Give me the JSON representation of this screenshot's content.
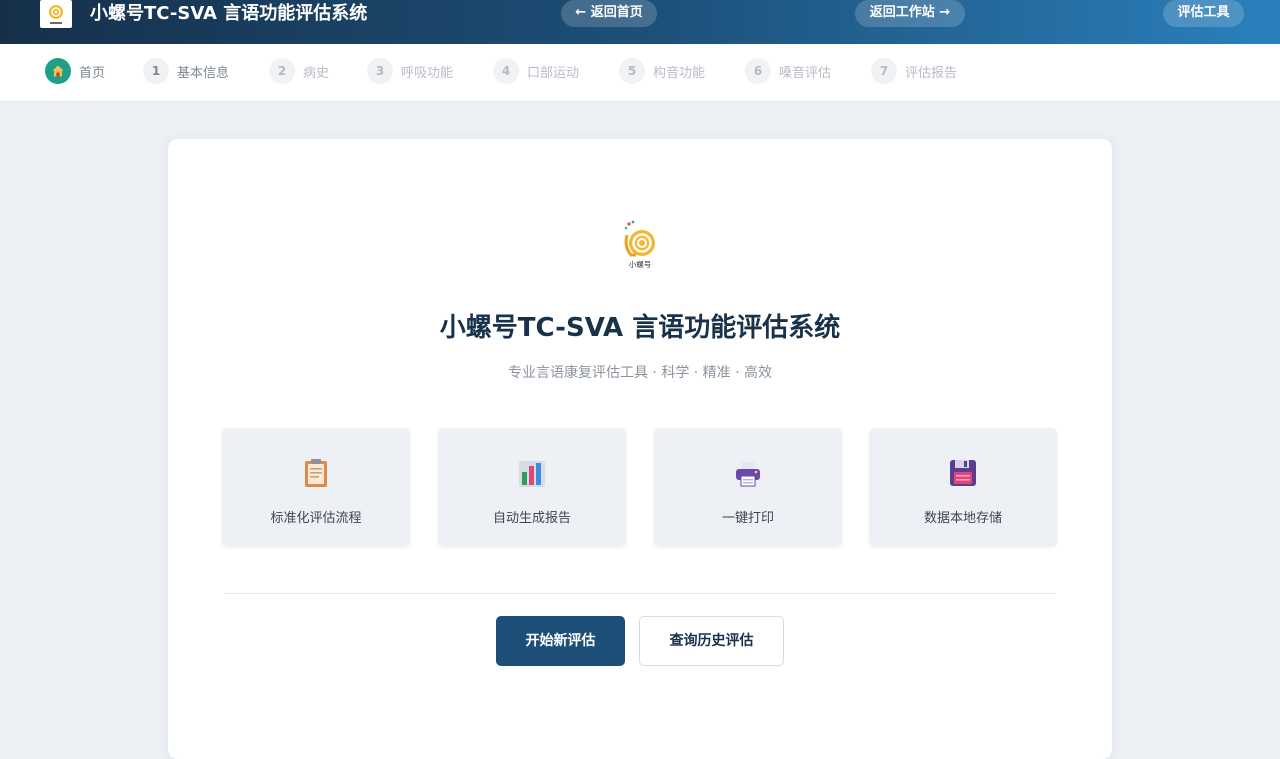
{
  "header": {
    "logo_icon": "snail-logo-icon",
    "title": "小螺号TC-SVA 言语功能评估系统",
    "back_home_label": "← 返回首页",
    "back_workstation_label": "返回工作站 →",
    "tools_label": "评估工具"
  },
  "steps": [
    {
      "number": "",
      "icon": "home-icon",
      "label": "首页",
      "state": "active"
    },
    {
      "number": "1",
      "label": "基本信息",
      "state": "next"
    },
    {
      "number": "2",
      "label": "病史",
      "state": "pending"
    },
    {
      "number": "3",
      "label": "呼吸功能",
      "state": "pending"
    },
    {
      "number": "4",
      "label": "口部运动",
      "state": "pending"
    },
    {
      "number": "5",
      "label": "构音功能",
      "state": "pending"
    },
    {
      "number": "6",
      "label": "嗓音评估",
      "state": "pending"
    },
    {
      "number": "7",
      "label": "评估报告",
      "state": "pending"
    }
  ],
  "main": {
    "logo_icon": "snail-logo-icon",
    "logo_caption": "小螺号",
    "title": "小螺号TC-SVA 言语功能评估系统",
    "subtitle": "专业言语康复评估工具 · 科学 · 精准 · 高效",
    "features": [
      {
        "icon": "clipboard-icon",
        "label": "标准化评估流程"
      },
      {
        "icon": "bar-chart-icon",
        "label": "自动生成报告"
      },
      {
        "icon": "printer-icon",
        "label": "一键打印"
      },
      {
        "icon": "floppy-disk-icon",
        "label": "数据本地存储"
      }
    ],
    "primary_button": "开始新评估",
    "secondary_button": "查询历史评估"
  },
  "colors": {
    "header_start": "#16304a",
    "header_end": "#2a80bd",
    "active_step": "#1d9f88",
    "primary_button": "#1c4e78",
    "title_text": "#17324a"
  }
}
